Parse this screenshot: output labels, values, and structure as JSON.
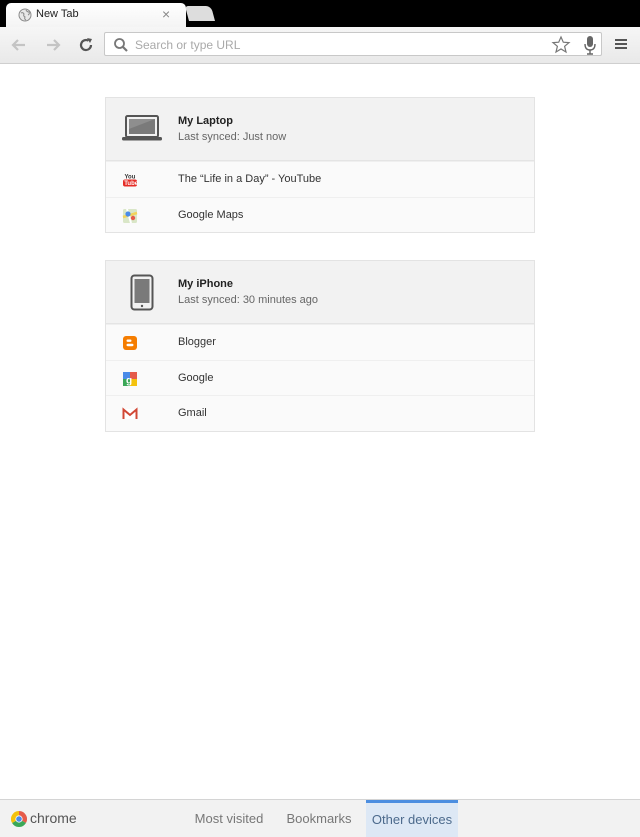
{
  "browser": {
    "tab_title": "New Tab",
    "tab_close": "×",
    "omnibox_placeholder": "Search or type URL"
  },
  "icons": {
    "tab_favicon": "globe-icon",
    "back": "arrow-left-icon",
    "forward": "arrow-right-icon",
    "reload": "reload-icon",
    "search": "magnifier-icon",
    "bookmark": "star-icon",
    "voice": "microphone-icon",
    "menu": "hamburger-icon"
  },
  "devices": [
    {
      "name": "My Laptop",
      "last_synced": "Last synced: Just now",
      "icon": "laptop-icon",
      "tabs": [
        {
          "title": "The “Life in a Day” - YouTube",
          "icon": "youtube-icon"
        },
        {
          "title": "Google Maps",
          "icon": "google-maps-icon"
        }
      ]
    },
    {
      "name": "My iPhone",
      "last_synced": "Last synced: 30 minutes ago",
      "icon": "phone-icon",
      "tabs": [
        {
          "title": "Blogger",
          "icon": "blogger-icon"
        },
        {
          "title": "Google",
          "icon": "google-icon"
        },
        {
          "title": "Gmail",
          "icon": "gmail-icon"
        }
      ]
    }
  ],
  "bottom_bar": {
    "brand": "chrome",
    "tabs": [
      {
        "label": "Most visited",
        "active": false
      },
      {
        "label": "Bookmarks",
        "active": false
      },
      {
        "label": "Other devices",
        "active": true
      }
    ]
  },
  "colors": {
    "active_tab_accent": "#4c8ee0",
    "active_tab_bg": "#dde8f5",
    "youtube_red": "#e52d27",
    "blogger_orange": "#f57d00",
    "gmail_red": "#d14836"
  }
}
